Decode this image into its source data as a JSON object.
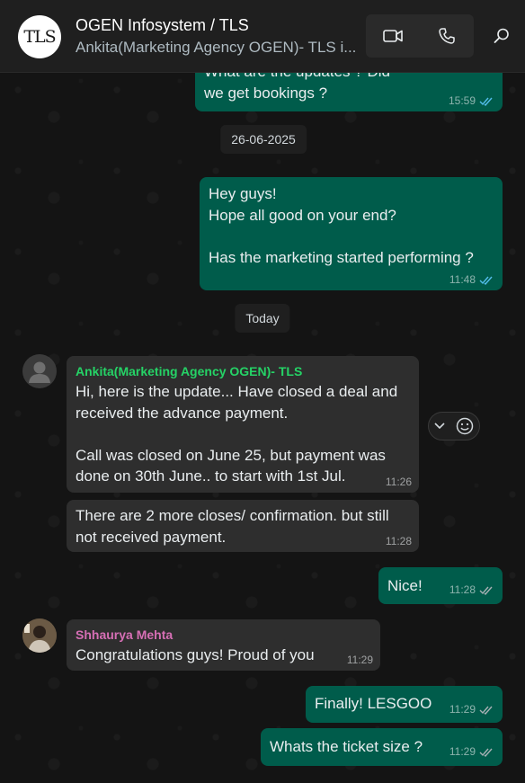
{
  "header": {
    "avatar_text": "TLS",
    "group_name": "OGEN Infosystem / TLS",
    "members": "Ankita(Marketing Agency OGEN)- TLS i..."
  },
  "icons": {
    "video": "video-call-icon",
    "voice": "voice-call-icon",
    "search": "search-icon",
    "ticks": "double-check-icon",
    "dropdown": "chevron-down-icon",
    "emoji": "emoji-icon"
  },
  "colors": {
    "outgoing": "#005c4b",
    "incoming": "#2e2e2e",
    "ankita_name": "#25d366",
    "shhaurya_name": "#d66fb5",
    "read_tick": "#53bdeb"
  },
  "dates": [
    "26-06-2025",
    "Today"
  ],
  "messages": [
    {
      "text": "What are the updates ? Did\nwe get bookings ?",
      "time": "15:59"
    },
    {
      "text": "Hey guys!\nHope all good on your end?\n\nHas the marketing started performing ?",
      "time": "11:48"
    },
    {
      "sender": "Ankita(Marketing Agency OGEN)- TLS",
      "text": "Hi, here is the update... Have closed a deal and\nreceived the advance payment.\n\nCall was closed on June 25, but payment was\ndone on 30th June.. to start with 1st Jul.",
      "time": "11:26"
    },
    {
      "text": "There are 2 more closes/ confirmation. but still\nnot received payment.",
      "time": "11:28"
    },
    {
      "text": "Nice!",
      "time": "11:28"
    },
    {
      "sender": "Shhaurya Mehta",
      "text": "Congratulations guys! Proud of you",
      "time": "11:29"
    },
    {
      "text": "Finally! LESGOO",
      "time": "11:29"
    },
    {
      "text": "Whats the ticket size ?",
      "time": "11:29"
    }
  ]
}
